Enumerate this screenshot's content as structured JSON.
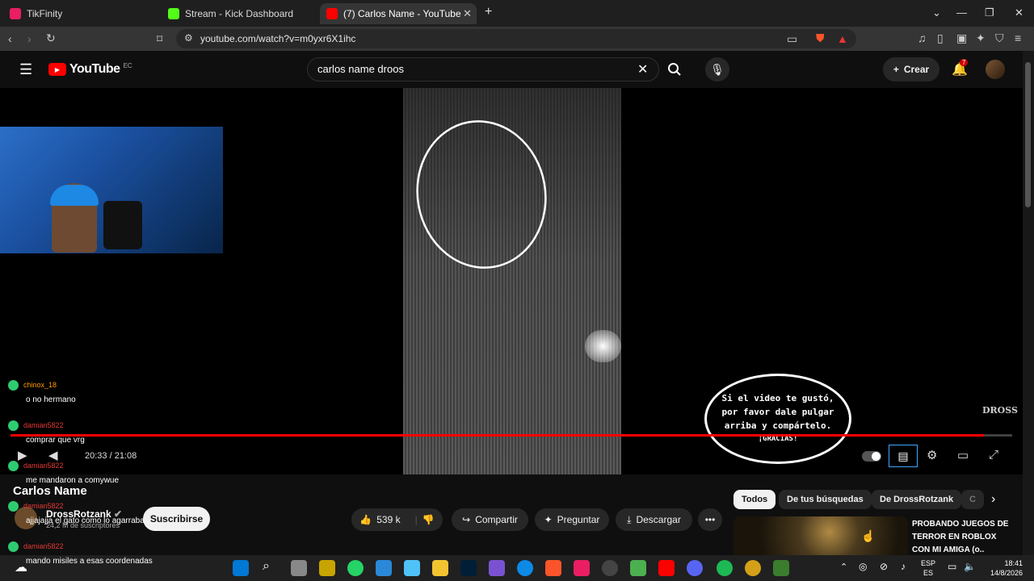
{
  "tabs": [
    {
      "title": "TikFinity",
      "color": "#e91e63"
    },
    {
      "title": "Stream - Kick Dashboard",
      "color": "#53fc18"
    },
    {
      "title": "(7) Carlos Name - YouTube",
      "color": "#ff0000"
    }
  ],
  "url": "youtube.com/watch?v=m0yxr6X1ihc",
  "yt": {
    "logo": "YouTube",
    "country": "EC",
    "search_value": "carlos name  droos",
    "create_label": "Crear",
    "notif_count": "7"
  },
  "player": {
    "time": "20:33 / 21:08",
    "progress": 0.972,
    "bubble": {
      "line1": "Si el video te gustó,",
      "line2": "por favor dale pulgar",
      "line3": "arriba y compártelo.",
      "line4": "¡GRACIAS!"
    },
    "watermark": "DROSS"
  },
  "chat": [
    {
      "user": "chinox_18",
      "msg": "o no hermano"
    },
    {
      "user": "damian5822",
      "msg": "comprar que vrg"
    },
    {
      "user": "damian5822",
      "msg": "me mandaron a comywue"
    },
    {
      "user": "damian5822",
      "msg": "ajjajajja el gato como lo agarraba"
    },
    {
      "user": "damian5822",
      "msg": "mando misiles a esas coordenadas"
    }
  ],
  "video": {
    "title": "Carlos Name",
    "channel": "DrossRotzank",
    "subs": "24,2 M de suscriptores",
    "subscribe": "Suscribirse",
    "likes": "539 k",
    "share": "Compartir",
    "ask": "Preguntar",
    "download": "Descargar"
  },
  "chips": [
    "Todos",
    "De tus búsquedas",
    "De DrossRotzank",
    "C"
  ],
  "rec": {
    "title_line1": "PROBANDO JUEGOS DE",
    "title_line2": "TERROR EN ROBLOX",
    "title_line3": "CON MI AMIGA (o.."
  },
  "taskbar": {
    "lang1": "ESP",
    "lang2": "ES",
    "time": "18:41",
    "date": "14/8/2026"
  }
}
